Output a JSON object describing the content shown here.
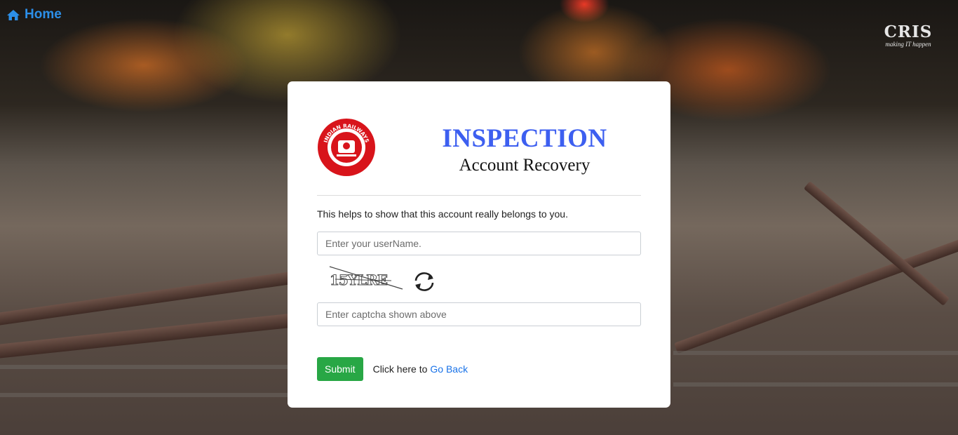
{
  "nav": {
    "home_label": "Home",
    "home_icon": "home-icon",
    "accent": "#2c8fe8"
  },
  "brand": {
    "logo_text": "CRIS",
    "logo_tagline": "making IT happen",
    "emblem_text": "INDIAN RAILWAYS"
  },
  "card": {
    "title": "INSPECTION",
    "subtitle": "Account Recovery",
    "title_color": "#3d5ff0",
    "info_text": "This helps to show that this account really belongs to you.",
    "username_placeholder": "Enter your userName.",
    "captcha_text": "15YLRE",
    "captcha_placeholder": "Enter captcha shown above",
    "submit_label": "Submit",
    "submit_color": "#28a745",
    "goback_prefix": "Click here to",
    "goback_link": "Go Back"
  }
}
